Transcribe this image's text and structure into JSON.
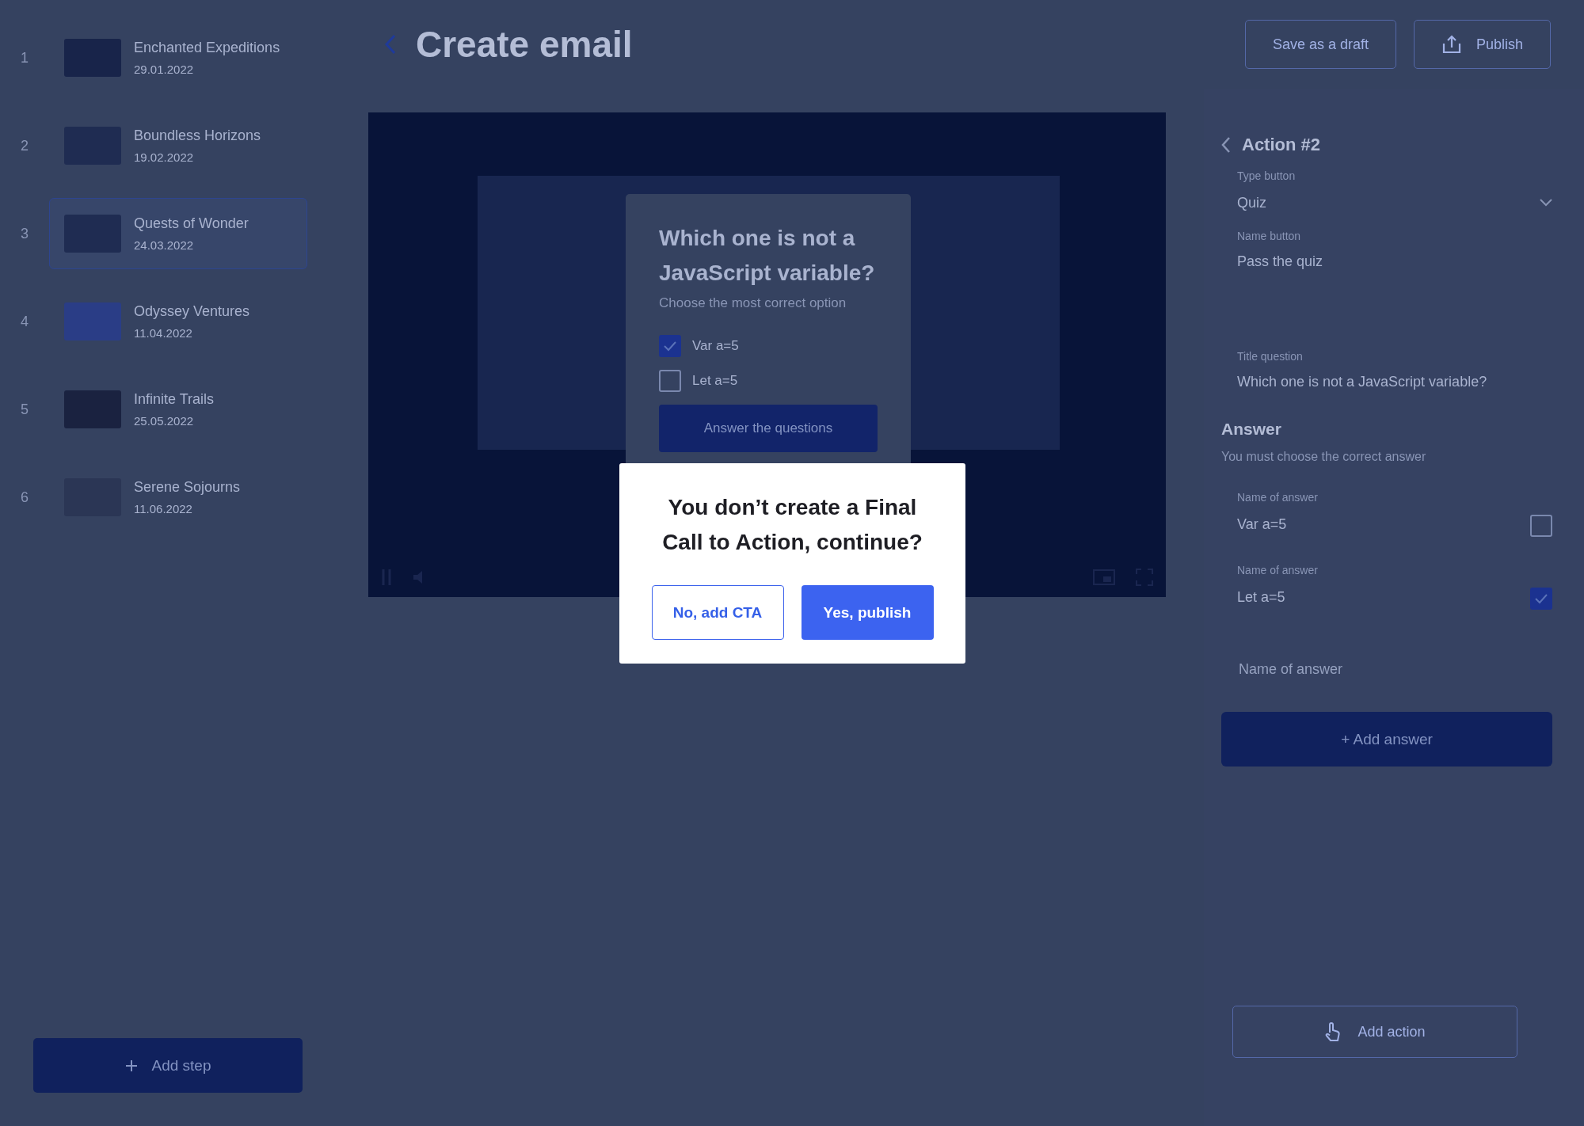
{
  "steps": [
    {
      "number": "1",
      "title": "Enchanted Expeditions",
      "date": "29.01.2022",
      "selected": false
    },
    {
      "number": "2",
      "title": "Boundless Horizons",
      "date": "19.02.2022",
      "selected": false
    },
    {
      "number": "3",
      "title": "Quests of Wonder",
      "date": "24.03.2022",
      "selected": true
    },
    {
      "number": "4",
      "title": "Odyssey Ventures",
      "date": "11.04.2022",
      "selected": false
    },
    {
      "number": "5",
      "title": "Infinite Trails",
      "date": "25.05.2022",
      "selected": false
    },
    {
      "number": "6",
      "title": "Serene Sojourns",
      "date": "11.06.2022",
      "selected": false
    }
  ],
  "add_step": "Add step",
  "header": {
    "title": "Create email",
    "save_draft": "Save as a draft",
    "publish": "Publish"
  },
  "quiz": {
    "question": "Which one is not a JavaScript variable?",
    "hint": "Choose the most correct option",
    "options": [
      {
        "label": "Var a=5",
        "checked": true
      },
      {
        "label": "Let a=5",
        "checked": false
      }
    ],
    "submit": "Answer the questions"
  },
  "dialog": {
    "message": "You don’t create a Final Call to Action, continue?",
    "cancel": "No, add CTA",
    "confirm": "Yes, publish"
  },
  "panel": {
    "title": "Action #2",
    "fields": [
      {
        "label": "Type button",
        "value": "Quiz",
        "kind": "select"
      },
      {
        "label": "Name button",
        "value": "Pass the quiz",
        "kind": "text"
      },
      {
        "label": "Title question",
        "value": "Which one is not a JavaScript variable?",
        "kind": "text"
      }
    ],
    "answer_heading": "Answer",
    "answer_hint": "You must choose the correct answer",
    "answers": [
      {
        "label": "Name of answer",
        "value": "Var a=5",
        "correct": false
      },
      {
        "label": "Name of answer",
        "value": "Let a=5",
        "correct": true
      }
    ],
    "new_answer": {
      "placeholder": "Name of answer"
    },
    "add_answer": "+ Add answer",
    "add_action": "Add action"
  }
}
